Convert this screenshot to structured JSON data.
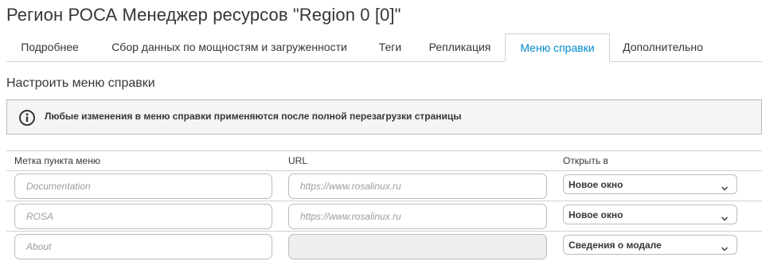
{
  "page": {
    "title": "Регион РОСА Менеджер ресурсов \"Region 0 [0]\""
  },
  "tabs": [
    {
      "label": "Подробнее",
      "active": false
    },
    {
      "label": "Сбор данных по мощностям и загруженности",
      "active": false
    },
    {
      "label": "Теги",
      "active": false
    },
    {
      "label": "Репликация",
      "active": false
    },
    {
      "label": "Меню справки",
      "active": true
    },
    {
      "label": "Дополнительно",
      "active": false
    }
  ],
  "section": {
    "title": "Настроить меню справки"
  },
  "alert": {
    "icon": "info-circle-icon",
    "text": "Любые изменения в меню справки применяются после полной перезагрузки страницы"
  },
  "table": {
    "headers": {
      "label": "Метка пункта меню",
      "url": "URL",
      "open_in": "Открыть в"
    },
    "rows": [
      {
        "label_placeholder": "Documentation",
        "url_placeholder": "https://www.rosalinux.ru",
        "url_disabled": false,
        "open_in": "Новое окно"
      },
      {
        "label_placeholder": "ROSA",
        "url_placeholder": "https://www.rosalinux.ru",
        "url_disabled": false,
        "open_in": "Новое окно"
      },
      {
        "label_placeholder": "About",
        "url_placeholder": "",
        "url_disabled": true,
        "open_in": "Сведения о модале"
      }
    ]
  },
  "colors": {
    "accent": "#0088ce",
    "text": "#363636",
    "border": "#d1d1d1",
    "alert_bg": "#f5f5f5",
    "disabled_bg": "#eeeeee"
  }
}
